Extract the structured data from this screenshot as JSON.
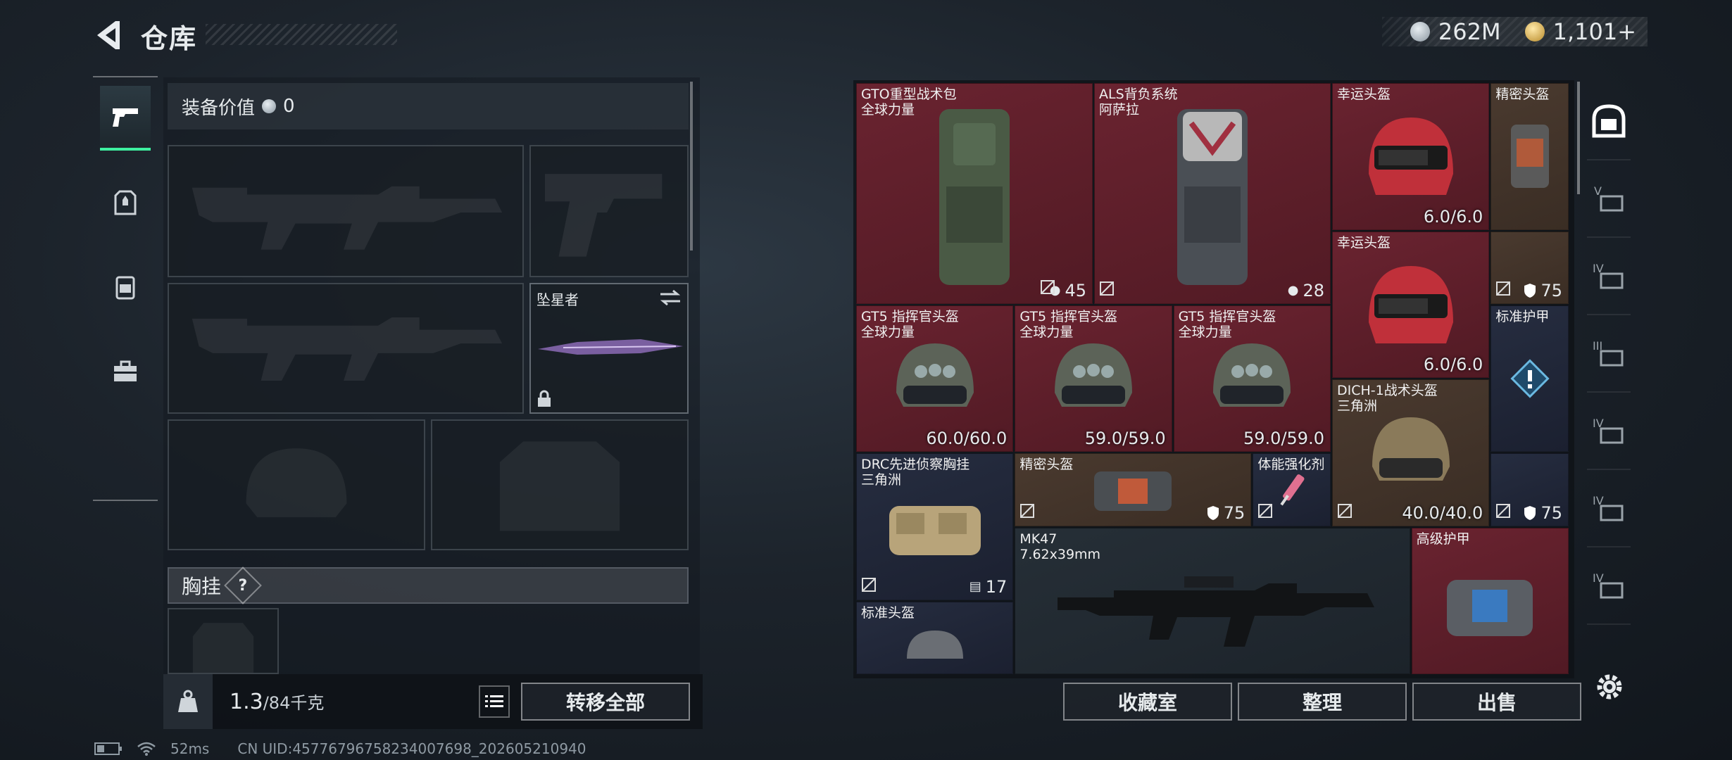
{
  "header": {
    "title": "仓库"
  },
  "currency": {
    "silver": "262M",
    "gold": "1,101+"
  },
  "equipment": {
    "value_label": "装备价值",
    "value": "0",
    "melee_name": "坠星者",
    "rig_label": "胸挂",
    "help": "?"
  },
  "weight": {
    "current": "1.3",
    "max": "/84千克"
  },
  "buttons": {
    "transfer_all": "转移全部",
    "collection": "收藏室",
    "sort": "整理",
    "sell": "出售"
  },
  "status": {
    "ping": "52ms",
    "uid": "CN UID:45776796758234007698_202605210940"
  },
  "stash": {
    "items": [
      {
        "name": "GTO重型战术包",
        "sub": "全球力量",
        "badge": "45",
        "color": "red"
      },
      {
        "name": "ALS背负系统",
        "sub": "阿萨拉",
        "badge": "28",
        "color": "red"
      },
      {
        "name": "幸运头盔",
        "value": "6.0/6.0",
        "color": "red"
      },
      {
        "name": "精密头盔",
        "color": "brown"
      },
      {
        "name": "幸运头盔",
        "value": "6.0/6.0",
        "color": "red"
      },
      {
        "badge": "75",
        "color": "brown"
      },
      {
        "name": "GT5 指挥官头盔",
        "sub": "全球力量",
        "value": "60.0/60.0",
        "color": "red"
      },
      {
        "name": "GT5 指挥官头盔",
        "sub": "全球力量",
        "value": "59.0/59.0",
        "color": "red"
      },
      {
        "name": "GT5 指挥官头盔",
        "sub": "全球力量",
        "value": "59.0/59.0",
        "color": "red"
      },
      {
        "name": "标准护甲",
        "color": "navy"
      },
      {
        "name": "DICH-1战术头盔",
        "sub": "三角洲",
        "value": "40.0/40.0",
        "color": "brown"
      },
      {
        "badge": "75",
        "color": "navy"
      },
      {
        "name": "DRC先进侦察胸挂",
        "sub": "三角洲",
        "badge": "17",
        "color": "navy"
      },
      {
        "name": "精密头盔",
        "badge": "75",
        "color": "brown"
      },
      {
        "name": "体能强化剂",
        "color": "navy"
      },
      {
        "name": "MK47",
        "sub": "7.62x39mm",
        "color": "dim"
      },
      {
        "name": "高级护甲",
        "color": "red"
      },
      {
        "name": "标准头盔",
        "color": "navy"
      }
    ]
  }
}
